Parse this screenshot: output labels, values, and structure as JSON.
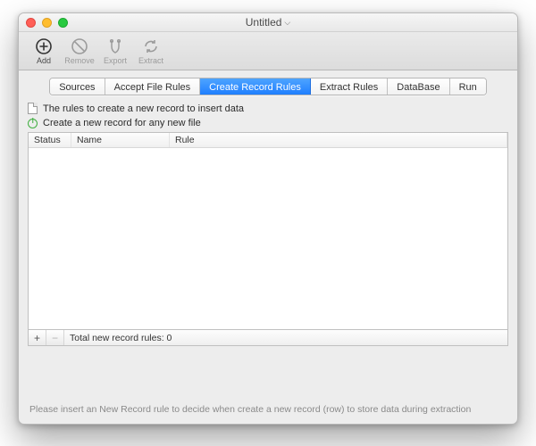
{
  "window": {
    "title": "Untitled"
  },
  "toolbar": {
    "add": "Add",
    "remove": "Remove",
    "export": "Export",
    "extract": "Extract"
  },
  "tabs": {
    "sources": "Sources",
    "accept": "Accept File Rules",
    "create": "Create Record Rules",
    "extract": "Extract Rules",
    "database": "DataBase",
    "run": "Run"
  },
  "panel": {
    "desc": "The rules to create a new record to insert data",
    "toggle": "Create a new record for any new file",
    "columns": {
      "status": "Status",
      "name": "Name",
      "rule": "Rule"
    },
    "total": "Total new record rules: 0"
  },
  "hint": "Please insert an New Record rule to decide when create a new record (row) to store data during extraction"
}
